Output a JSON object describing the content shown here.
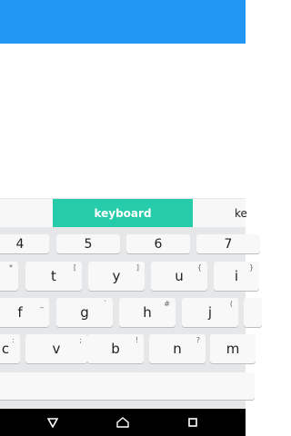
{
  "keyboard": {
    "suggestions": {
      "center": "keyboard",
      "right": "ke"
    },
    "number_row": [
      "4",
      "5",
      "6",
      "7"
    ],
    "row1": [
      {
        "label": "",
        "sub": "*"
      },
      {
        "label": "t",
        "sub": "["
      },
      {
        "label": "y",
        "sub": "]"
      },
      {
        "label": "u",
        "sub": "{"
      },
      {
        "label": "i",
        "sub": "}"
      }
    ],
    "row2": [
      {
        "label": "f",
        "sub": "_"
      },
      {
        "label": "g",
        "sub": "`"
      },
      {
        "label": "h",
        "sub": "#"
      },
      {
        "label": "j",
        "sub": "("
      },
      {
        "label": "",
        "sub": ""
      }
    ],
    "row3": [
      {
        "label": "c",
        "sub": ":"
      },
      {
        "label": "v",
        "sub": ";"
      },
      {
        "label": "b",
        "sub": "!"
      },
      {
        "label": "n",
        "sub": "?"
      },
      {
        "label": "m",
        "sub": ""
      }
    ]
  },
  "colors": {
    "appbar": "#2196f3",
    "suggestion_accent": "#26cca9"
  },
  "nav": {
    "back_icon": "back-triangle-icon",
    "home_icon": "home-icon",
    "recents_icon": "recents-square-icon"
  }
}
